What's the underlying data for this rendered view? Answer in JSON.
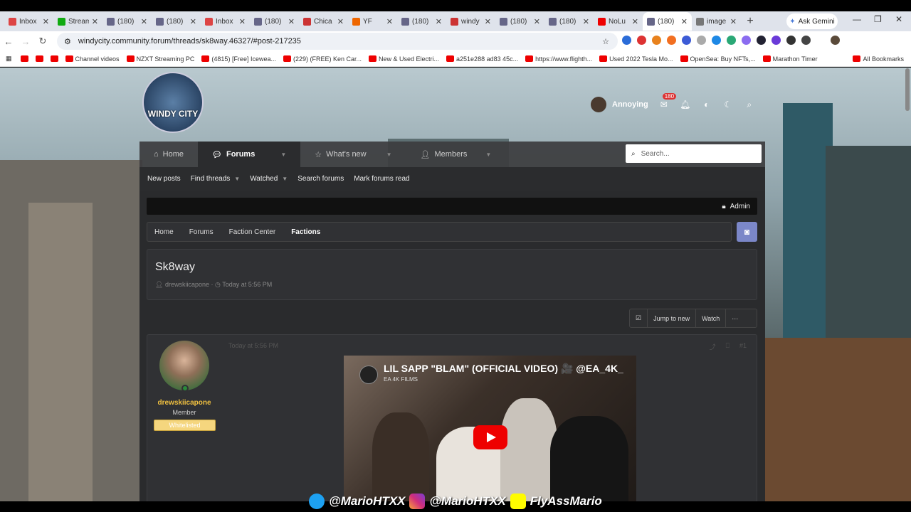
{
  "tabs": [
    {
      "title": "Inbox",
      "color": "#d44"
    },
    {
      "title": "Stream",
      "color": "#1a1"
    },
    {
      "title": "(180)",
      "color": "#668"
    },
    {
      "title": "(180)",
      "color": "#668"
    },
    {
      "title": "Inbox",
      "color": "#d44"
    },
    {
      "title": "(180)",
      "color": "#668"
    },
    {
      "title": "Chica",
      "color": "#c33"
    },
    {
      "title": "YF",
      "color": "#e60"
    },
    {
      "title": "(180)",
      "color": "#668"
    },
    {
      "title": "windy",
      "color": "#c33"
    },
    {
      "title": "(180)",
      "color": "#668"
    },
    {
      "title": "(180)",
      "color": "#668"
    },
    {
      "title": "NoLu",
      "color": "#e00"
    },
    {
      "title": "(180)",
      "color": "#668",
      "active": true
    },
    {
      "title": "image",
      "color": "#777"
    }
  ],
  "chrome": {
    "gemini": "Ask Gemini",
    "url": "windycity.community.forum/threads/sk8way.46327/#post-217235"
  },
  "bookmarks": [
    "Channel videos",
    "NZXT Streaming PC",
    "(4815) [Free] Icewea...",
    "(229) (FREE) Ken Car...",
    "New & Used Electri...",
    "a251e288 ad83 45c...",
    "https://www.flighth...",
    "Used 2022 Tesla Mo...",
    "OpenSea: Buy NFTs,...",
    "Marathon Timer",
    "All Bookmarks"
  ],
  "site": {
    "logo": "WINDY CITY",
    "user": "Annoying",
    "inbox_count": "180",
    "nav": [
      {
        "label": "Home"
      },
      {
        "label": "Forums",
        "active": true
      },
      {
        "label": "What's new"
      },
      {
        "label": "Members"
      }
    ],
    "search_placeholder": "Search...",
    "subnav": [
      "New posts",
      "Find threads",
      "Watched",
      "Search forums",
      "Mark forums read"
    ],
    "admin": "Admin",
    "breadcrumbs": [
      "Home",
      "Forums",
      "Faction Center",
      "Factions"
    ]
  },
  "thread": {
    "title": "Sk8way",
    "author": "drewskiicapone",
    "date": "Today at 5:56 PM",
    "actions": [
      "Jump to new",
      "Watch",
      "···"
    ]
  },
  "post": {
    "username": "drewskiicapone",
    "role": "Member",
    "badge": "Whitelisted",
    "date": "Today at 5:56 PM",
    "number": "#1",
    "video": {
      "title": "LIL SAPP \"BLAM\" (OFFICIAL VIDEO) 🎥 @EA_4K_",
      "channel": "EA 4K FILMS"
    }
  },
  "watermark": {
    "twitter": "@MarioHTXX",
    "instagram": "@MarioHTXX",
    "snapchat": "FlyAssMario"
  },
  "colors": {
    "accent": "#f0c040",
    "badge": "#f5d67e",
    "discord": "#7b87c8"
  }
}
